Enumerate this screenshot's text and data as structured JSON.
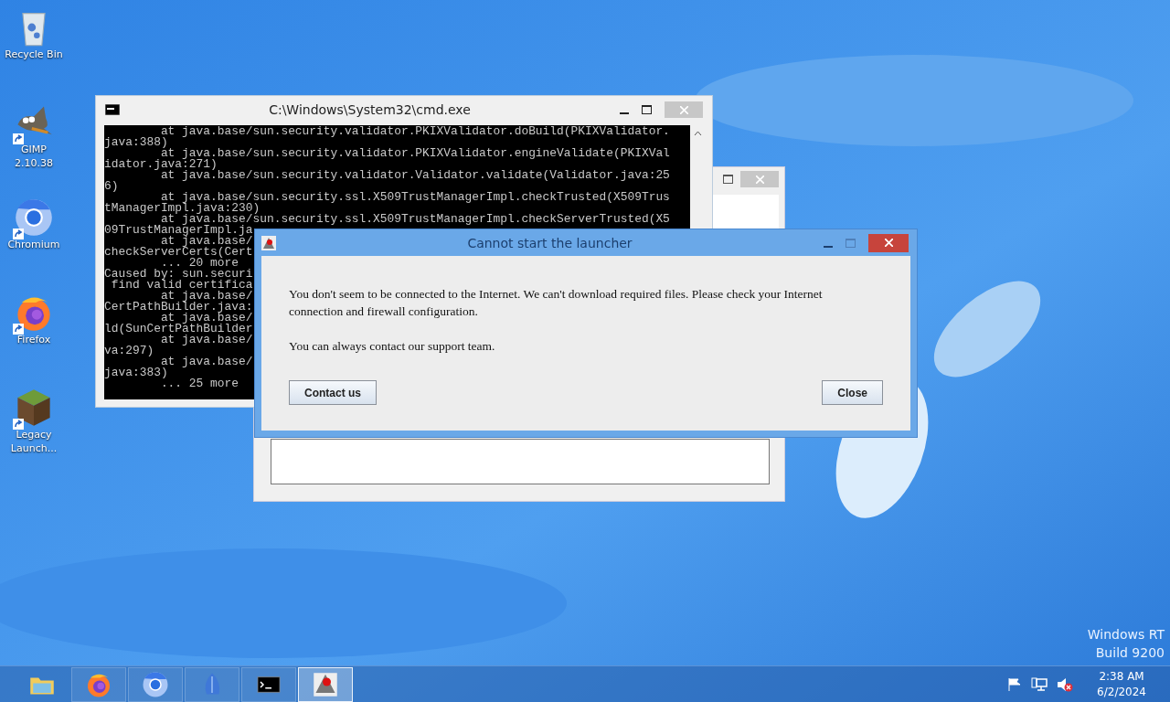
{
  "desktop_icons": [
    {
      "kind": "recycle",
      "label": "Recycle Bin",
      "shortcut": false
    },
    {
      "kind": "gimp",
      "label": "GIMP 2.10.38",
      "shortcut": true
    },
    {
      "kind": "chromium",
      "label": "Chromium",
      "shortcut": true
    },
    {
      "kind": "firefox",
      "label": "Firefox",
      "shortcut": true
    },
    {
      "kind": "block",
      "label": "Legacy Launch...",
      "shortcut": true
    }
  ],
  "console_window": {
    "title": "C:\\Windows\\System32\\cmd.exe",
    "lines": [
      "        at java.base/sun.security.validator.PKIXValidator.doBuild(PKIXValidator.",
      "java:388)",
      "        at java.base/sun.security.validator.PKIXValidator.engineValidate(PKIXVal",
      "idator.java:271)",
      "        at java.base/sun.security.validator.Validator.validate(Validator.java:25",
      "6)",
      "        at java.base/sun.security.ssl.X509TrustManagerImpl.checkTrusted(X509Trus",
      "tManagerImpl.java:230)",
      "        at java.base/sun.security.ssl.X509TrustManagerImpl.checkServerTrusted(X5",
      "09TrustManagerImpl.ja",
      "        at java.base/",
      "checkServerCerts(Cert",
      "        ... 20 more",
      "Caused by: sun.securi",
      " find valid certifica",
      "        at java.base/",
      "CertPathBuilder.java:",
      "        at java.base/",
      "ld(SunCertPathBuilder",
      "        at java.base/",
      "va:297)",
      "        at java.base/",
      "java:383)",
      "        ... 25 more"
    ]
  },
  "dialog": {
    "title": "Cannot start the launcher",
    "message": "You don't seem to be connected to the Internet. We can't download required files. Please check your Internet connection and firewall configuration.",
    "note": "You can always contact our support team.",
    "buttons": [
      {
        "kind": "left",
        "label": "Contact us"
      },
      {
        "kind": "right",
        "label": "Close"
      }
    ]
  },
  "watermark": [
    "Windows RT",
    "Build 9200"
  ],
  "taskbar": {
    "apps": [
      {
        "kind": "explorer",
        "selected": false
      },
      {
        "kind": "firefox",
        "selected": false
      },
      {
        "kind": "chromium",
        "selected": false
      },
      {
        "kind": "feather",
        "selected": false
      },
      {
        "kind": "console",
        "selected": false
      },
      {
        "kind": "java",
        "selected": true
      }
    ],
    "tray": [
      {
        "kind": "flag"
      },
      {
        "kind": "network"
      },
      {
        "kind": "muted"
      }
    ],
    "time": "2:38 AM",
    "date": "6/2/2024"
  }
}
